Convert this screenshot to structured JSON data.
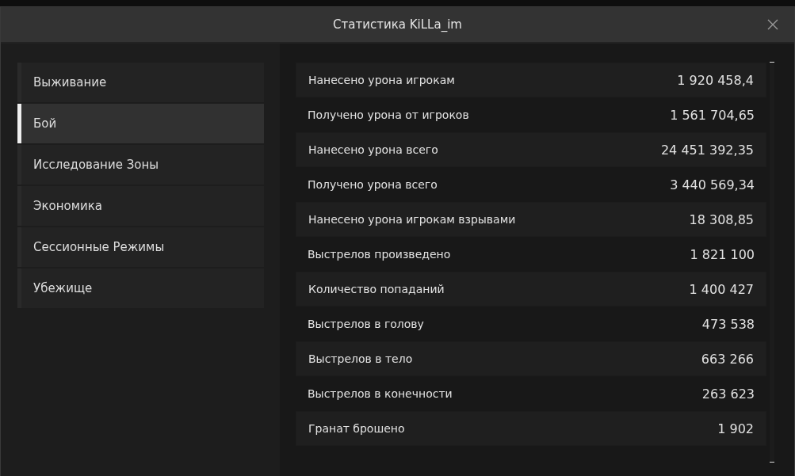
{
  "window": {
    "title": "Статистика KiLLa_im"
  },
  "sidebar": {
    "items": [
      {
        "label": "Выживание",
        "selected": false
      },
      {
        "label": "Бой",
        "selected": true
      },
      {
        "label": "Исследование Зоны",
        "selected": false
      },
      {
        "label": "Экономика",
        "selected": false
      },
      {
        "label": "Сессионные Режимы",
        "selected": false
      },
      {
        "label": "Убежище",
        "selected": false
      }
    ]
  },
  "stats": [
    {
      "label": "Нанесено урона игрокам",
      "value": "1 920 458,4"
    },
    {
      "label": "Получено урона от игроков",
      "value": "1 561 704,65"
    },
    {
      "label": "Нанесено урона всего",
      "value": "24 451 392,35"
    },
    {
      "label": "Получено урона всего",
      "value": "3 440 569,34"
    },
    {
      "label": "Нанесено урона игрокам взрывами",
      "value": "18 308,85"
    },
    {
      "label": "Выстрелов произведено",
      "value": "1 821 100"
    },
    {
      "label": "Количество попаданий",
      "value": "1 400 427"
    },
    {
      "label": "Выстрелов в голову",
      "value": "473 538"
    },
    {
      "label": "Выстрелов в тело",
      "value": "663 266"
    },
    {
      "label": "Выстрелов в конечности",
      "value": "263 623"
    },
    {
      "label": "Гранат брошено",
      "value": "1 902"
    }
  ]
}
